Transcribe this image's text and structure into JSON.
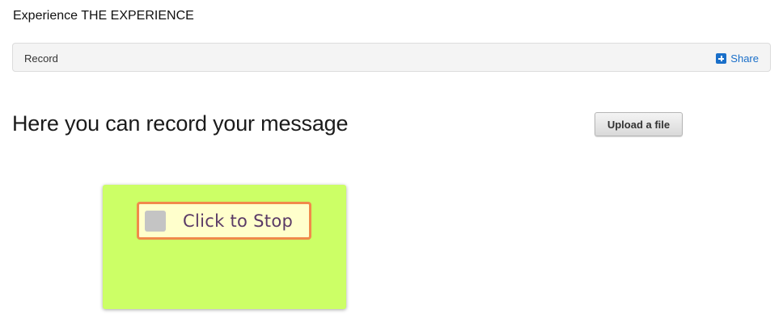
{
  "header": {
    "site_title": "Experience THE EXPERIENCE"
  },
  "nav": {
    "record_label": "Record",
    "share_label": "Share",
    "share_icon": "plus-square-icon"
  },
  "main": {
    "heading": "Here you can record your message",
    "upload_button_label": "Upload a file"
  },
  "recorder": {
    "stop_label": "Click to Stop",
    "stop_icon": "stop-square-icon",
    "panel_color": "#ccff66",
    "button_border_color": "#f08a4b"
  },
  "colors": {
    "link": "#1a6fc9"
  }
}
